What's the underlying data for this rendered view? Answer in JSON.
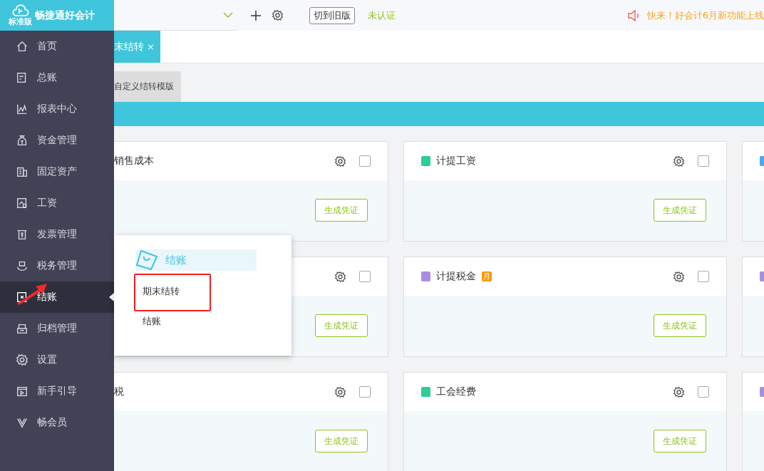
{
  "logo": {
    "name": "畅捷通好会计",
    "edition": "标准版"
  },
  "sidebar": {
    "items": [
      {
        "label": "首页",
        "selected": false
      },
      {
        "label": "总账",
        "selected": false
      },
      {
        "label": "报表中心",
        "selected": false
      },
      {
        "label": "资金管理",
        "selected": false
      },
      {
        "label": "固定资产",
        "selected": false
      },
      {
        "label": "工资",
        "selected": false
      },
      {
        "label": "发票管理",
        "selected": false
      },
      {
        "label": "税务管理",
        "selected": false
      },
      {
        "label": "结账",
        "selected": true
      },
      {
        "label": "归档管理",
        "selected": false
      },
      {
        "label": "设置",
        "selected": false
      },
      {
        "label": "新手引导",
        "selected": false
      },
      {
        "label": "畅会员",
        "selected": false
      }
    ]
  },
  "toolbar": {
    "switch_button": "切到旧版",
    "auth_status": "未认证",
    "notice": "快来！好会计6月新功能上线"
  },
  "tabs": [
    {
      "label": "末结转",
      "selected": true,
      "close": "×"
    }
  ],
  "sub_tabs": [
    {
      "label": "自定义结转模版",
      "selected": false
    }
  ],
  "card_rows": [
    {
      "cards": [
        {
          "title": "销售成本",
          "checked": false,
          "button": "生成凭证"
        },
        {
          "title": "计提工资",
          "color": "#2ecc9a",
          "checked": false,
          "button": "生成凭证"
        },
        {
          "color": "#4aa8f0"
        }
      ]
    },
    {
      "cards": [
        {
          "checked": false,
          "button": "生成凭证"
        },
        {
          "title": "计提税金",
          "color": "#a98ee0",
          "badge": "月",
          "checked": false,
          "button": "生成凭证"
        },
        {
          "color": "#a98ee0"
        }
      ]
    },
    {
      "cards": [
        {
          "title": "税",
          "checked": false,
          "button": "生成凭证"
        },
        {
          "title": "工会经费",
          "color": "#2ecc9a",
          "checked": false,
          "button": "生成凭证"
        },
        {
          "color": "#a98ee0"
        }
      ]
    }
  ],
  "popup": {
    "title": "结账",
    "items": [
      {
        "label": "期末结转",
        "highlighted": true
      },
      {
        "label": "结账",
        "highlighted": false
      }
    ]
  }
}
